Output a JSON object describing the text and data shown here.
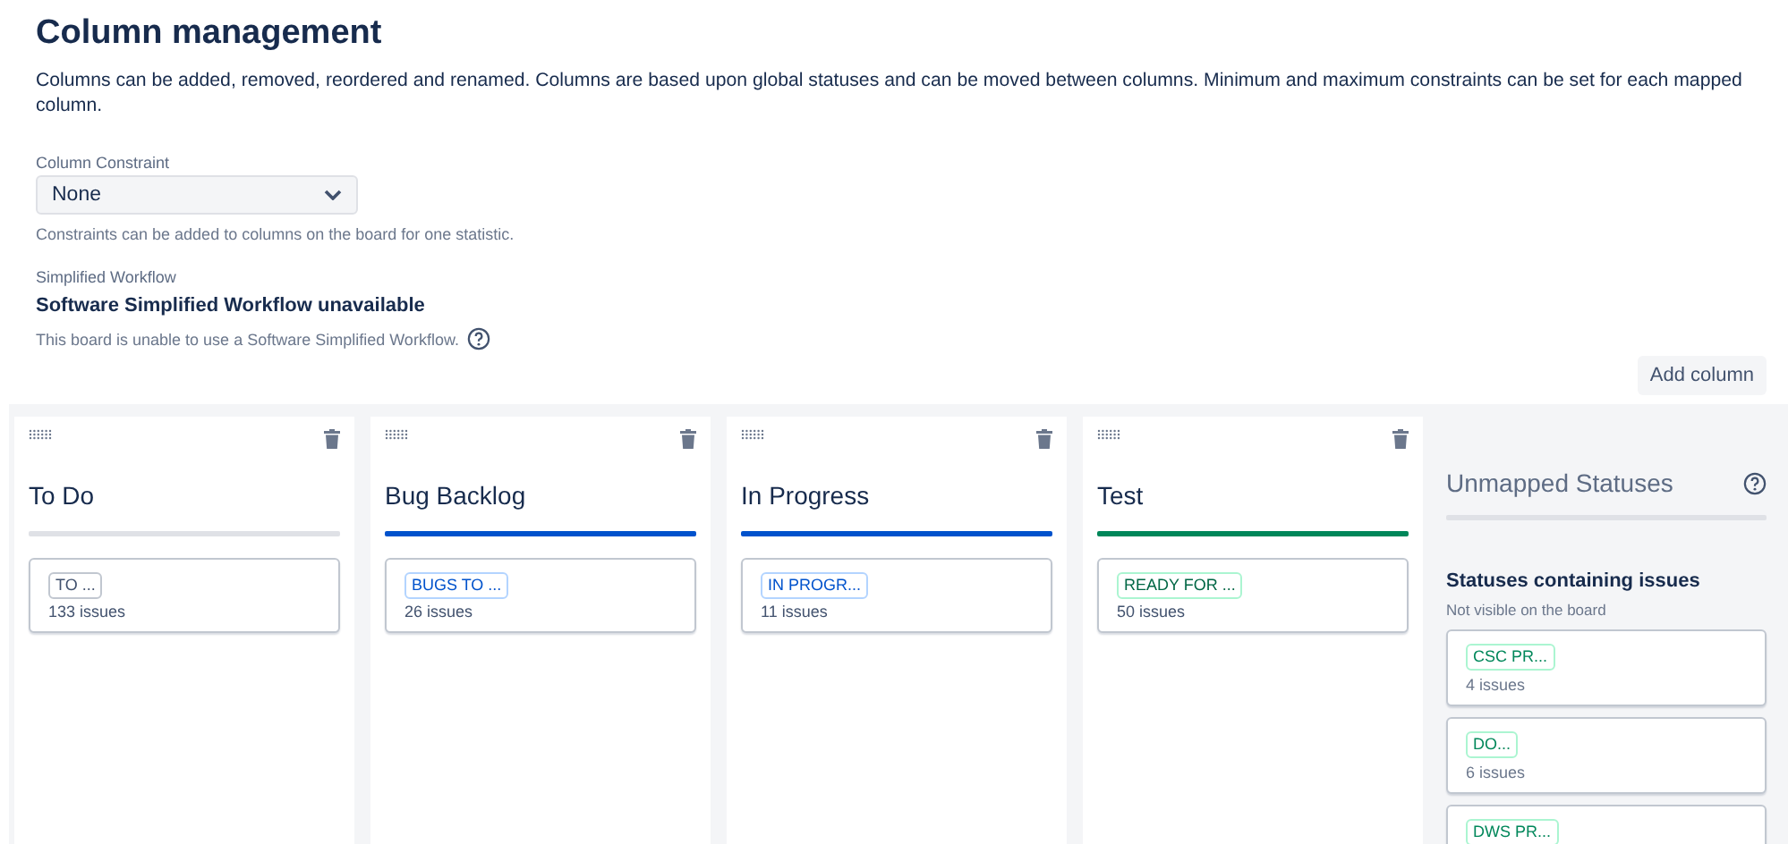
{
  "page": {
    "title": "Column management",
    "description": "Columns can be added, removed, reordered and renamed. Columns are based upon global statuses and can be moved between columns. Minimum and maximum constraints can be set for each mapped column."
  },
  "constraint": {
    "label": "Column Constraint",
    "value": "None",
    "help": "Constraints can be added to columns on the board for one statistic."
  },
  "workflow": {
    "label": "Simplified Workflow",
    "status": "Software Simplified Workflow unavailable",
    "help": "This board is unable to use a Software Simplified Workflow."
  },
  "add_button": "Add column",
  "columns": [
    {
      "name": "To Do",
      "color": "#dfe1e6",
      "statuses": [
        {
          "label": "TO ...",
          "count": "133 issues"
        }
      ]
    },
    {
      "name": "Bug Backlog",
      "color": "#0052cc",
      "statuses": [
        {
          "label": "BUGS TO ...",
          "count": "26 issues"
        }
      ]
    },
    {
      "name": "In Progress",
      "color": "#0052cc",
      "statuses": [
        {
          "label": "IN PROGR...",
          "count": "11 issues"
        }
      ]
    },
    {
      "name": "Test",
      "color": "#00875a",
      "statuses": [
        {
          "label": "READY FOR ...",
          "count": "50 issues"
        }
      ]
    }
  ],
  "unmapped": {
    "title": "Unmapped Statuses",
    "section_title": "Statuses containing issues",
    "section_hint": "Not visible on the board",
    "statuses": [
      {
        "label": "CSC PR...",
        "count": "4 issues",
        "color": "#00875a"
      },
      {
        "label": "DO...",
        "count": "6 issues",
        "color": "#00875a"
      },
      {
        "label": "DWS PR...",
        "color": "#00875a"
      }
    ]
  }
}
